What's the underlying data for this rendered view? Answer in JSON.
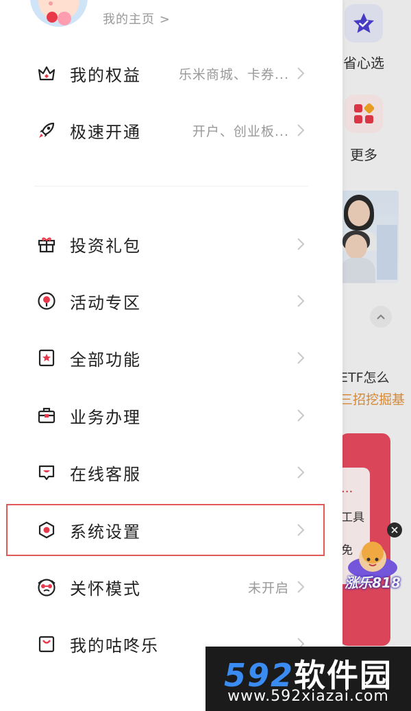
{
  "background": {
    "shortcut_1_label": "省心选",
    "shortcut_2_label": "更多",
    "etf_text": "ETF怎么",
    "etf_sub": "三招挖掘基",
    "card_title": "...",
    "card_line_1": "工具",
    "card_line_2": "免",
    "mascot_label": "涨乐818"
  },
  "drawer": {
    "homepage_link": "我的主页 >",
    "items": [
      {
        "label": "我的权益",
        "sub": "乐米商城、卡券...",
        "icon": "crown-icon"
      },
      {
        "label": "极速开通",
        "sub": "开户、创业板...",
        "icon": "rocket-icon"
      },
      {
        "label": "投资礼包",
        "sub": "",
        "icon": "gift-icon"
      },
      {
        "label": "活动专区",
        "sub": "",
        "icon": "pin-icon"
      },
      {
        "label": "全部功能",
        "sub": "",
        "icon": "star-square-icon"
      },
      {
        "label": "业务办理",
        "sub": "",
        "icon": "briefcase-icon"
      },
      {
        "label": "在线客服",
        "sub": "",
        "icon": "chat-icon"
      },
      {
        "label": "系统设置",
        "sub": "",
        "icon": "settings-icon"
      },
      {
        "label": "关怀模式",
        "sub": "未开启",
        "icon": "care-mode-icon"
      },
      {
        "label": "我的咕咚乐",
        "sub": "",
        "icon": "bag-icon"
      }
    ]
  },
  "watermark": {
    "number": "592",
    "name": "软件园",
    "url": "www.592xiazai.com"
  },
  "colors": {
    "accent_red": "#e8394a",
    "highlight_border": "#e05a5a",
    "text_primary": "#222222",
    "text_secondary": "#999999"
  }
}
